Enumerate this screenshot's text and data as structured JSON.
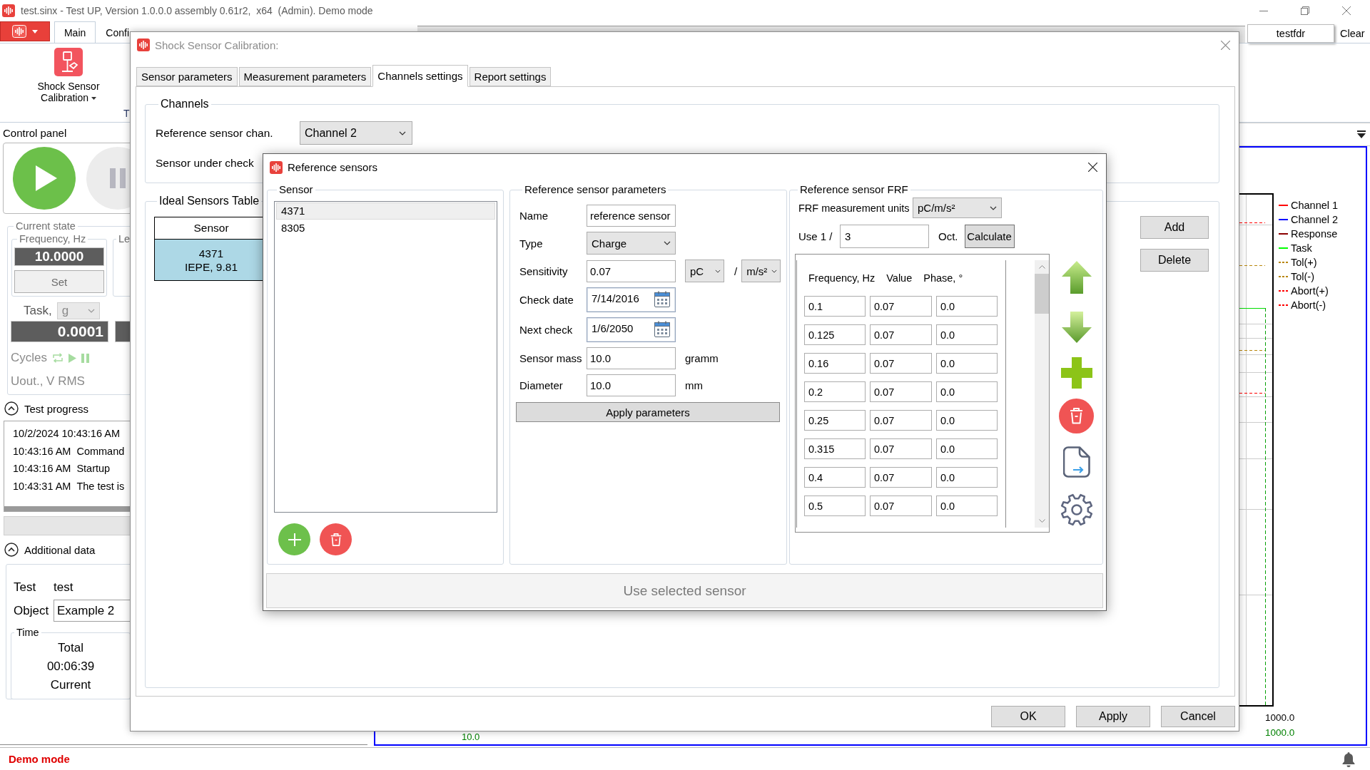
{
  "window": {
    "title": "test.sinx - Test UP, Version 1.0.0.0 assembly 0.61r2,  x64  (Admin). Demo mode"
  },
  "ribbon": {
    "tabs": [
      {
        "label": "Main",
        "selected": true
      },
      {
        "label": "Confi",
        "selected": false
      }
    ],
    "command": "Shock Sensor Calibration",
    "group_label": "T"
  },
  "document_tabs": [
    {
      "label": "testfdr",
      "selected": true
    }
  ],
  "clear_button": "Clear",
  "control_panel": {
    "title": "Control panel",
    "current_state": {
      "title": "Current state",
      "frequency_title": "Frequency, Hz",
      "frequency_value": "10.0000",
      "set_button": "Set",
      "level_title": "Le",
      "task_label": "Task,",
      "task_unit": "g",
      "task_value": "0.0001",
      "cycles_label": "Cycles",
      "uout_label": "Uout., V RMS"
    },
    "test_progress": {
      "title": "Test progress",
      "expanded": true,
      "log": [
        {
          "time": "10/2/2024 10:43:16 AM"
        },
        {
          "time": "10:43:16 AM",
          "message": "Command"
        },
        {
          "time": "10:43:16 AM",
          "message": "Startup"
        },
        {
          "time": "10:43:31 AM",
          "message": "The test is"
        }
      ]
    },
    "progress": {
      "level": 0
    },
    "additional_data": {
      "title": "Additional data",
      "expanded": true,
      "test_label": "Test",
      "test_value": "test",
      "object_label": "Object",
      "object_value": "Example 2",
      "time_title": "Time",
      "total_label": "Total",
      "total_value": "00:06:39",
      "current_label": "Current"
    }
  },
  "calibration_dialog": {
    "title": "Shock Sensor Calibration:",
    "active": false,
    "tabs": [
      {
        "label": "Sensor parameters",
        "selected": false
      },
      {
        "label": "Measurement parameters",
        "selected": false
      },
      {
        "label": "Channels settings",
        "selected": true
      },
      {
        "label": "Report settings",
        "selected": false
      }
    ],
    "channels": {
      "title": "Channels",
      "reference_label": "Reference sensor chan.",
      "reference_value": "Channel 2",
      "under_check_label": "Sensor under check"
    },
    "ideal_sensors": {
      "title": "Ideal Sensors Table",
      "column": "Sensor",
      "rows": [
        {
          "lines": [
            "4371",
            "IEPE, 9.81"
          ],
          "selected": true
        }
      ],
      "buttons": [
        "Add",
        "Delete"
      ]
    },
    "buttons": [
      "OK",
      "Apply",
      "Cancel"
    ]
  },
  "reference_dialog": {
    "title": "Reference sensors",
    "active": true,
    "sensor_group": {
      "title": "Sensor",
      "items": [
        {
          "label": "4371",
          "selected": true
        },
        {
          "label": "8305",
          "selected": false
        }
      ]
    },
    "parameters": {
      "title": "Reference sensor parameters",
      "fields": [
        {
          "kind": "text",
          "label": "Name",
          "value": "reference sensor"
        },
        {
          "kind": "dropdown",
          "label": "Type",
          "value": "Charge"
        },
        {
          "kind": "text",
          "label": "Sensitivity",
          "value": "0.07",
          "unit_dropdowns": [
            "pC",
            "m/s²"
          ],
          "unit_separator": "/"
        },
        {
          "kind": "date",
          "label": "Check date",
          "value": "7/14/2016"
        },
        {
          "kind": "date",
          "label": "Next check",
          "value": "1/6/2050"
        },
        {
          "kind": "text",
          "label": "Sensor mass",
          "value": "10.0",
          "unit": "gramm"
        },
        {
          "kind": "text",
          "label": "Diameter",
          "value": "10.0",
          "unit": "mm"
        }
      ],
      "apply_button": "Apply parameters"
    },
    "frf": {
      "title": "Reference sensor FRF",
      "units_label": "FRF measurement units",
      "units_value": "pC/m/s²",
      "octave_label": "Use 1 /",
      "octave_value": "3",
      "octave_unit": "Oct.",
      "calculate_button": "Calculate",
      "columns": [
        "Frequency, Hz",
        "Value",
        "Phase, °"
      ],
      "rows": [
        [
          "0.1",
          "0.07",
          "0.0"
        ],
        [
          "0.125",
          "0.07",
          "0.0"
        ],
        [
          "0.16",
          "0.07",
          "0.0"
        ],
        [
          "0.2",
          "0.07",
          "0.0"
        ],
        [
          "0.25",
          "0.07",
          "0.0"
        ],
        [
          "0.315",
          "0.07",
          "0.0"
        ],
        [
          "0.4",
          "0.07",
          "0.0"
        ],
        [
          "0.5",
          "0.07",
          "0.0"
        ]
      ]
    },
    "use_button": {
      "label": "Use selected sensor",
      "disabled": true
    }
  },
  "chart": {
    "legend": [
      {
        "label": "Channel 1",
        "color": "#ff0000",
        "kind": "solid"
      },
      {
        "label": "Channel 2",
        "color": "#0000ff",
        "kind": "solid"
      },
      {
        "label": "Response",
        "color": "#8b0000",
        "kind": "solid"
      },
      {
        "label": "Task",
        "color": "#00ff00",
        "kind": "solid"
      },
      {
        "label": "Tol(+)",
        "color": "#b8860b",
        "kind": "dashed"
      },
      {
        "label": "Tol(-)",
        "color": "#b8860b",
        "kind": "dashed"
      },
      {
        "label": "Abort(+)",
        "color": "#ff0000",
        "kind": "dashed"
      },
      {
        "label": "Abort(-)",
        "color": "#ff0000",
        "kind": "dashed"
      }
    ],
    "x_start_label": "10.0",
    "x_end_labels": [
      {
        "text": "1000.0",
        "color": "#000000"
      },
      {
        "text": "1000.0",
        "color": "#008000"
      }
    ]
  },
  "status_bar": {
    "mode": "Demo mode"
  }
}
